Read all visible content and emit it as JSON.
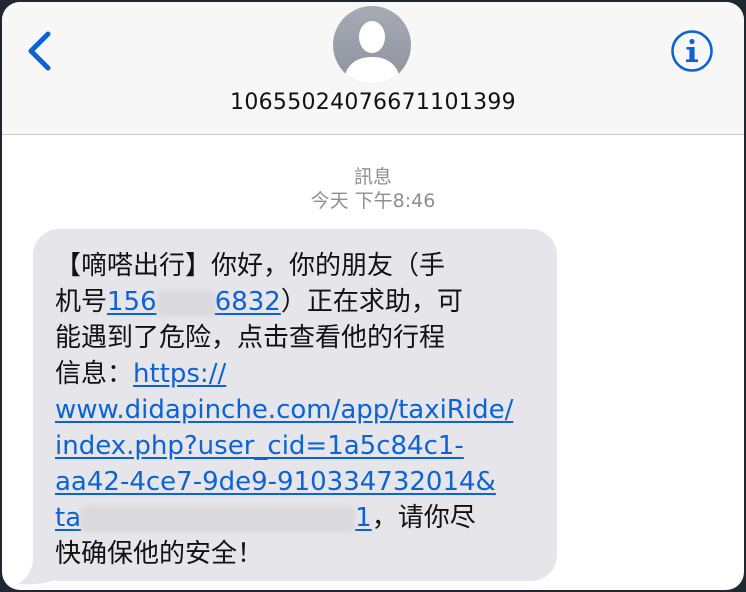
{
  "header": {
    "sender_number": "10655024076671101399"
  },
  "thread": {
    "service_label": "訊息",
    "timestamp": "今天 下午8:46"
  },
  "message": {
    "line1": "【嘀嗒出行】你好，你的朋友（手",
    "line2_prefix": "机号",
    "phone_start": "156",
    "phone_end": "6832",
    "line2_suffix": "）正在求助，可",
    "line3": "能遇到了危险，点击查看他的行程",
    "line4_prefix": "信息：",
    "link_line1": "https://",
    "link_line2": "www.didapinche.com/app/taxiRide/",
    "link_line3": "index.php?user_cid=1a5c84c1-",
    "link_line4": "aa42-4ce7-9de9-910334732014&",
    "link_line5_start": "ta",
    "link_line5_end": "1",
    "line8_suffix": "，请你尽",
    "line9": "快确保他的安全！"
  },
  "colors": {
    "accent": "#0b63d6",
    "bubble": "#e5e5ea",
    "meta_text": "#8e8e93",
    "nav_bg": "#f7f7f7"
  },
  "icons": [
    "chevron-left-icon",
    "contact-avatar-icon",
    "info-icon"
  ]
}
